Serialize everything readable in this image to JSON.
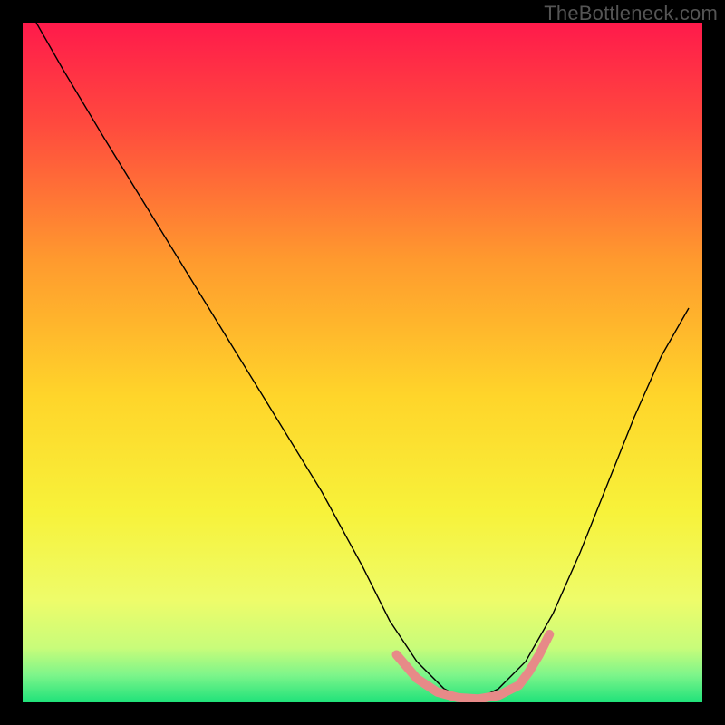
{
  "watermark": "TheBottleneck.com",
  "chart_data": {
    "type": "line",
    "title": "",
    "xlabel": "",
    "ylabel": "",
    "xlim": [
      0,
      100
    ],
    "ylim": [
      0,
      100
    ],
    "grid": false,
    "legend": false,
    "background_gradient": {
      "orientation": "vertical",
      "stops": [
        {
          "offset": 0.0,
          "color": "#ff1a4b"
        },
        {
          "offset": 0.15,
          "color": "#ff4a3e"
        },
        {
          "offset": 0.35,
          "color": "#ff9a2e"
        },
        {
          "offset": 0.55,
          "color": "#ffd52a"
        },
        {
          "offset": 0.72,
          "color": "#f7f23a"
        },
        {
          "offset": 0.85,
          "color": "#eefc6a"
        },
        {
          "offset": 0.92,
          "color": "#c8fc7a"
        },
        {
          "offset": 0.96,
          "color": "#7df58a"
        },
        {
          "offset": 1.0,
          "color": "#1fe27a"
        }
      ]
    },
    "series": [
      {
        "name": "bottleneck-curve",
        "color": "#000000",
        "width": 1.4,
        "x": [
          2,
          6,
          12,
          20,
          28,
          36,
          44,
          50,
          54,
          58,
          62,
          66,
          70,
          74,
          78,
          82,
          86,
          90,
          94,
          98
        ],
        "y": [
          100,
          93,
          83,
          70,
          57,
          44,
          31,
          20,
          12,
          6,
          2,
          0,
          2,
          6,
          13,
          22,
          32,
          42,
          51,
          58
        ]
      },
      {
        "name": "highlight-band",
        "color": "#e78a88",
        "width": 10,
        "linecap": "round",
        "x": [
          55,
          58,
          61,
          64,
          67,
          70,
          73,
          74.5,
          76,
          77.5
        ],
        "y": [
          7,
          3.5,
          1.5,
          0.7,
          0.5,
          1,
          2.5,
          4.5,
          7,
          10
        ]
      }
    ]
  }
}
